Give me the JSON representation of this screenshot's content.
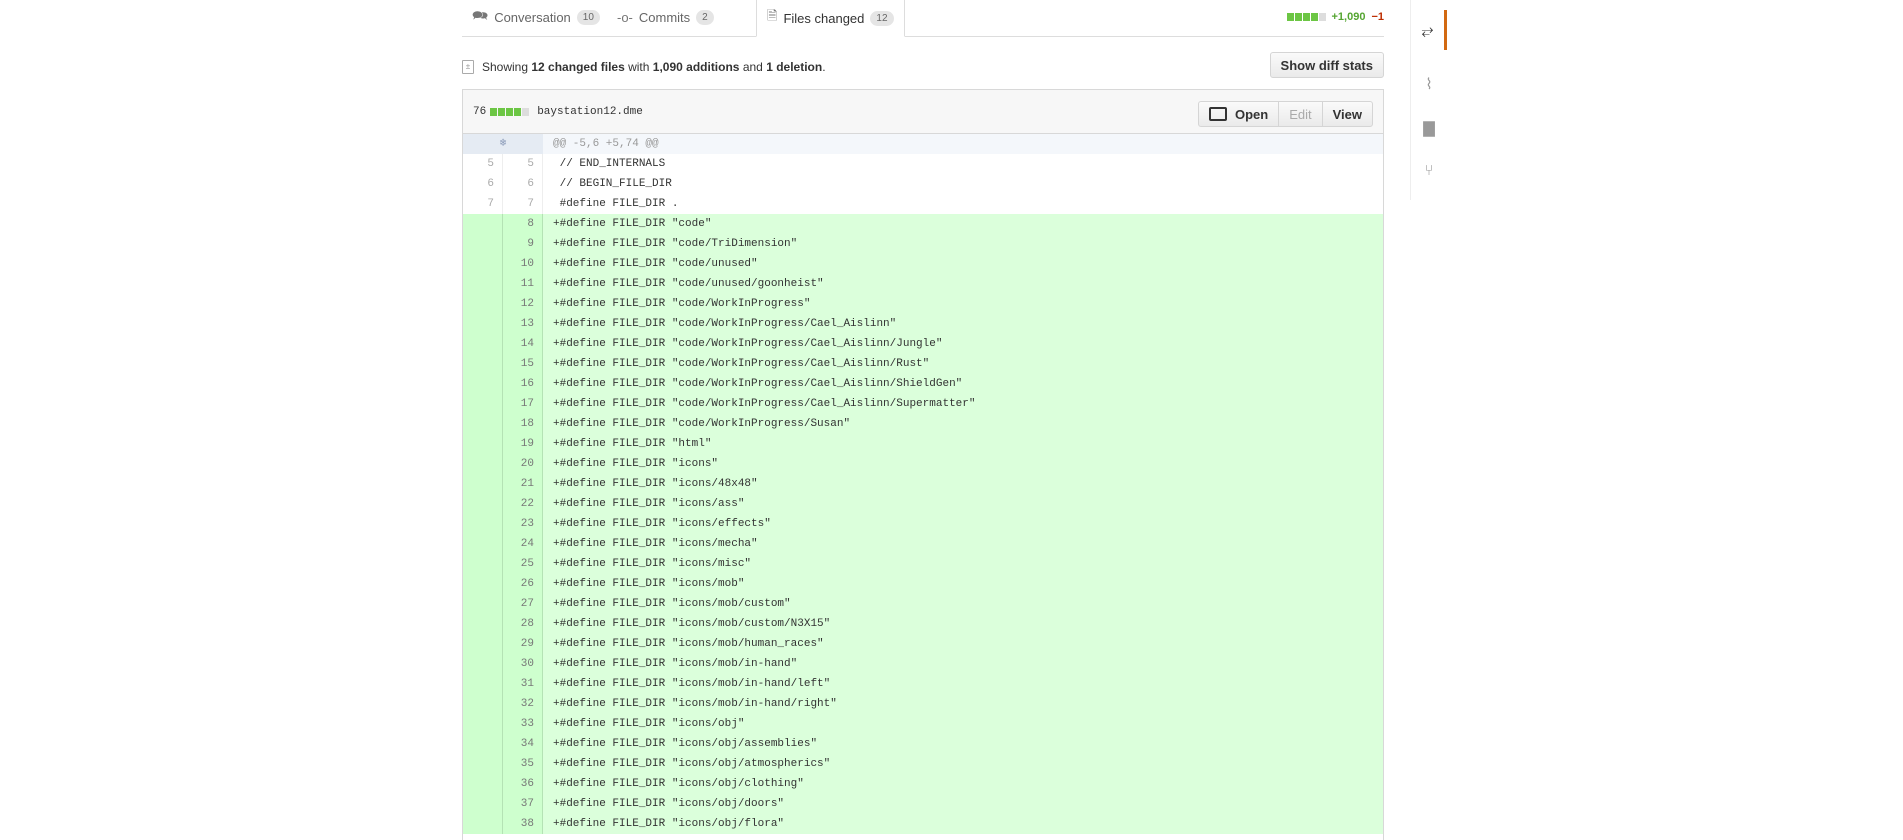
{
  "tabs": [
    {
      "label": "Conversation",
      "count": "10",
      "icon": "comment-icon"
    },
    {
      "label": "Commits",
      "count": "2",
      "icon": "commit-icon"
    },
    {
      "label": "Files changed",
      "count": "12",
      "icon": "file-diff-icon"
    }
  ],
  "diffstat": {
    "additions": "+1,090",
    "deletions": "−1"
  },
  "toc": {
    "showing": "Showing",
    "changed_files": "12 changed files",
    "with": "with",
    "additions": "1,090 additions",
    "and": "and",
    "deletions": "1 deletion",
    "period": ".",
    "show_diff_stats": "Show diff stats"
  },
  "file": {
    "changes": "76",
    "name": "baystation12.dme",
    "open_label": "Open",
    "edit_label": "Edit",
    "view_label": "View",
    "hunk": "@@ -5,6 +5,74 @@",
    "context_lines": [
      {
        "old": "5",
        "new": "5",
        "text": " // END_INTERNALS"
      },
      {
        "old": "6",
        "new": "6",
        "text": " // BEGIN_FILE_DIR"
      },
      {
        "old": "7",
        "new": "7",
        "text": " #define FILE_DIR ."
      }
    ],
    "added_lines": [
      {
        "new": "8",
        "text": "+#define FILE_DIR \"code\""
      },
      {
        "new": "9",
        "text": "+#define FILE_DIR \"code/TriDimension\""
      },
      {
        "new": "10",
        "text": "+#define FILE_DIR \"code/unused\""
      },
      {
        "new": "11",
        "text": "+#define FILE_DIR \"code/unused/goonheist\""
      },
      {
        "new": "12",
        "text": "+#define FILE_DIR \"code/WorkInProgress\""
      },
      {
        "new": "13",
        "text": "+#define FILE_DIR \"code/WorkInProgress/Cael_Aislinn\""
      },
      {
        "new": "14",
        "text": "+#define FILE_DIR \"code/WorkInProgress/Cael_Aislinn/Jungle\""
      },
      {
        "new": "15",
        "text": "+#define FILE_DIR \"code/WorkInProgress/Cael_Aislinn/Rust\""
      },
      {
        "new": "16",
        "text": "+#define FILE_DIR \"code/WorkInProgress/Cael_Aislinn/ShieldGen\""
      },
      {
        "new": "17",
        "text": "+#define FILE_DIR \"code/WorkInProgress/Cael_Aislinn/Supermatter\""
      },
      {
        "new": "18",
        "text": "+#define FILE_DIR \"code/WorkInProgress/Susan\""
      },
      {
        "new": "19",
        "text": "+#define FILE_DIR \"html\""
      },
      {
        "new": "20",
        "text": "+#define FILE_DIR \"icons\""
      },
      {
        "new": "21",
        "text": "+#define FILE_DIR \"icons/48x48\""
      },
      {
        "new": "22",
        "text": "+#define FILE_DIR \"icons/ass\""
      },
      {
        "new": "23",
        "text": "+#define FILE_DIR \"icons/effects\""
      },
      {
        "new": "24",
        "text": "+#define FILE_DIR \"icons/mecha\""
      },
      {
        "new": "25",
        "text": "+#define FILE_DIR \"icons/misc\""
      },
      {
        "new": "26",
        "text": "+#define FILE_DIR \"icons/mob\""
      },
      {
        "new": "27",
        "text": "+#define FILE_DIR \"icons/mob/custom\""
      },
      {
        "new": "28",
        "text": "+#define FILE_DIR \"icons/mob/custom/N3X15\""
      },
      {
        "new": "29",
        "text": "+#define FILE_DIR \"icons/mob/human_races\""
      },
      {
        "new": "30",
        "text": "+#define FILE_DIR \"icons/mob/in-hand\""
      },
      {
        "new": "31",
        "text": "+#define FILE_DIR \"icons/mob/in-hand/left\""
      },
      {
        "new": "32",
        "text": "+#define FILE_DIR \"icons/mob/in-hand/right\""
      },
      {
        "new": "33",
        "text": "+#define FILE_DIR \"icons/obj\""
      },
      {
        "new": "34",
        "text": "+#define FILE_DIR \"icons/obj/assemblies\""
      },
      {
        "new": "35",
        "text": "+#define FILE_DIR \"icons/obj/atmospherics\""
      },
      {
        "new": "36",
        "text": "+#define FILE_DIR \"icons/obj/clothing\""
      },
      {
        "new": "37",
        "text": "+#define FILE_DIR \"icons/obj/doors\""
      },
      {
        "new": "38",
        "text": "+#define FILE_DIR \"icons/obj/flora\""
      }
    ]
  },
  "sidebar": [
    "pull-request-icon",
    "pulse-icon",
    "graph-icon",
    "branch-icon"
  ]
}
